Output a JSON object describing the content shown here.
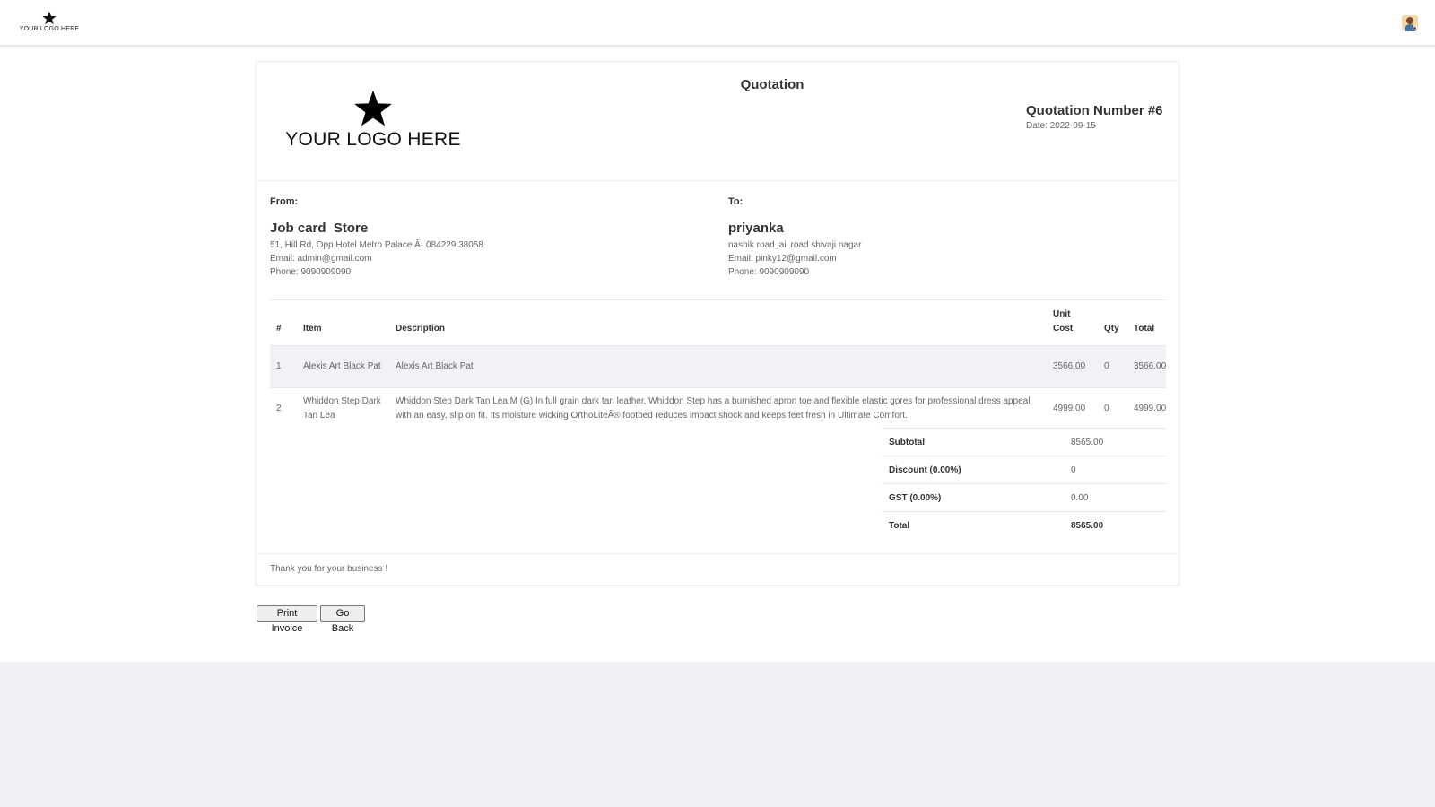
{
  "header": {
    "logo_text": "YOUR LOGO HERE",
    "avatar_icon": "user-avatar-icon"
  },
  "quotation": {
    "title": "Quotation",
    "logo_text": "YOUR LOGO HERE",
    "number_label": "Quotation Number #6",
    "date_label": "Date: 2022-09-15"
  },
  "from": {
    "label": "From:",
    "name": "Job card  Store",
    "address": "51, Hill Rd, Opp Hotel Metro Palace Â· 084229 38058",
    "email": "Email: admin@gmail.com",
    "phone": "Phone: 9090909090"
  },
  "to": {
    "label": "To:",
    "name": "priyanka",
    "address": "nashik road jail road shivaji nagar",
    "email": "Email: pinky12@gmail.com",
    "phone": "Phone: 9090909090"
  },
  "table": {
    "headers": {
      "num": "#",
      "item": "Item",
      "description": "Description",
      "unit_cost": "Unit Cost",
      "qty": "Qty",
      "total": "Total"
    },
    "rows": [
      {
        "num": "1",
        "item": "Alexis Art Black Pat",
        "description": "Alexis Art Black Pat",
        "unit_cost": "3566.00",
        "qty": "0",
        "total": "3566.00"
      },
      {
        "num": "2",
        "item": "Whiddon Step Dark Tan Lea",
        "description": "Whiddon Step Dark Tan Lea,M (G) In full grain dark tan leather, Whiddon Step has a burnished apron toe and flexible elastic gores for professional dress appeal with an easy, slip on fit. Its moisture wicking OrthoLiteÂ® footbed reduces impact shock and keeps feet fresh in Ultimate Comfort.",
        "unit_cost": "4999.00",
        "qty": "0",
        "total": "4999.00"
      }
    ]
  },
  "totals": {
    "subtotal_label": "Subtotal",
    "subtotal_value": "8565.00",
    "discount_label": "Discount (0.00%)",
    "discount_value": "0",
    "gst_label": "GST (0.00%)",
    "gst_value": "0.00",
    "total_label": "Total",
    "total_value": "8565.00"
  },
  "footer": {
    "message": "Thank you for your business !"
  },
  "actions": {
    "print_label": "Print Invoice",
    "back_label": "Go Back"
  }
}
